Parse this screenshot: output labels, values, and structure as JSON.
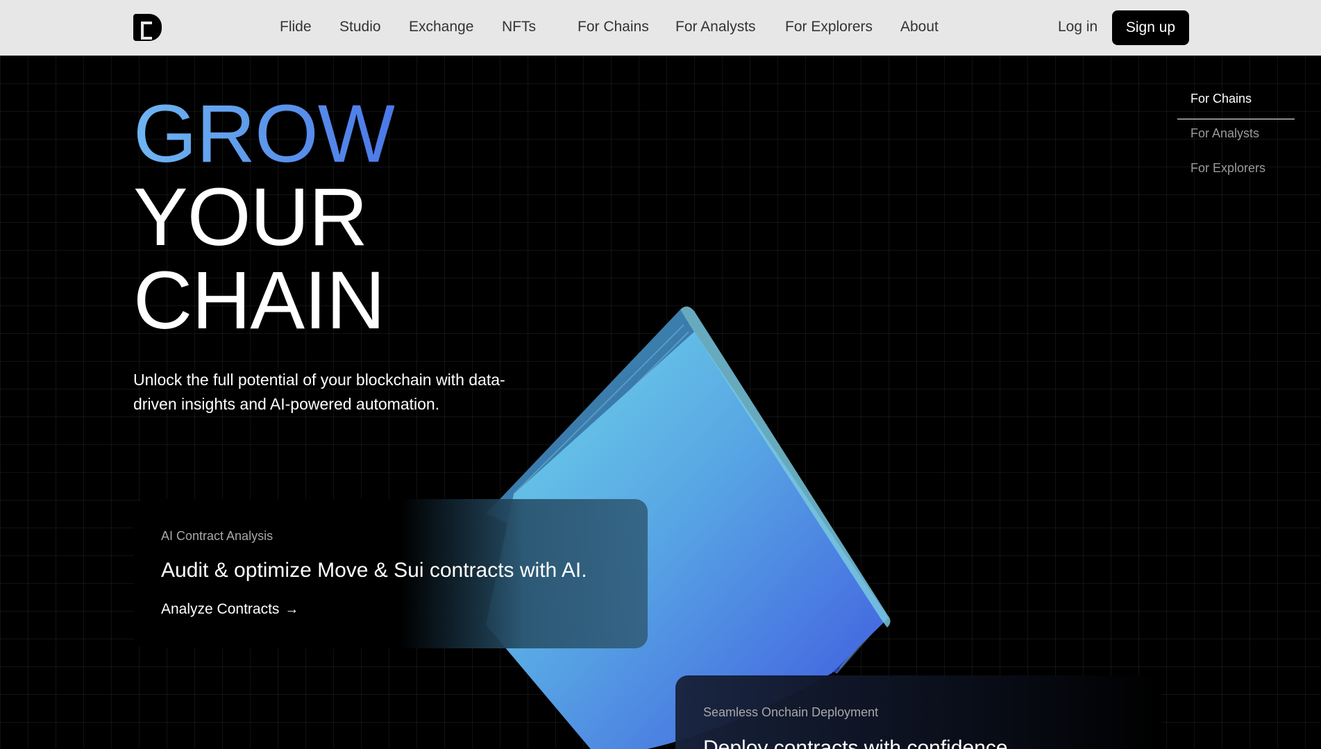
{
  "nav": {
    "links": [
      "Flide",
      "Studio",
      "Exchange",
      "NFTs",
      "For Chains",
      "For Analysts",
      "For Explorers",
      "About"
    ],
    "login": "Log in",
    "signup": "Sign up"
  },
  "hero": {
    "line1": "GROW",
    "line2": "YOUR",
    "line3": "CHAIN",
    "subtitle": "Unlock the full potential of your blockchain with data-driven insights and AI-powered automation."
  },
  "side_menu": {
    "items": [
      "For Chains",
      "For Analysts",
      "For Explorers"
    ],
    "active": "For Chains"
  },
  "cards": [
    {
      "label": "AI Contract Analysis",
      "title": "Audit & optimize Move & Sui contracts with AI.",
      "link": "Analyze Contracts"
    },
    {
      "label": "Seamless Onchain Deployment",
      "title": "Deploy contracts with confidence"
    }
  ],
  "icons": {
    "logo": "logo-icon",
    "card_link_arrow": "arrow-right-icon"
  },
  "colors": {
    "nav_bg": "#e7e7e7",
    "signup_bg": "#000000",
    "accent_gradient_start": "#6fb6f0",
    "accent_gradient_end": "#4b78e8",
    "slab_top": "#6fd0e4",
    "slab_bottom": "#3d5ee0"
  }
}
